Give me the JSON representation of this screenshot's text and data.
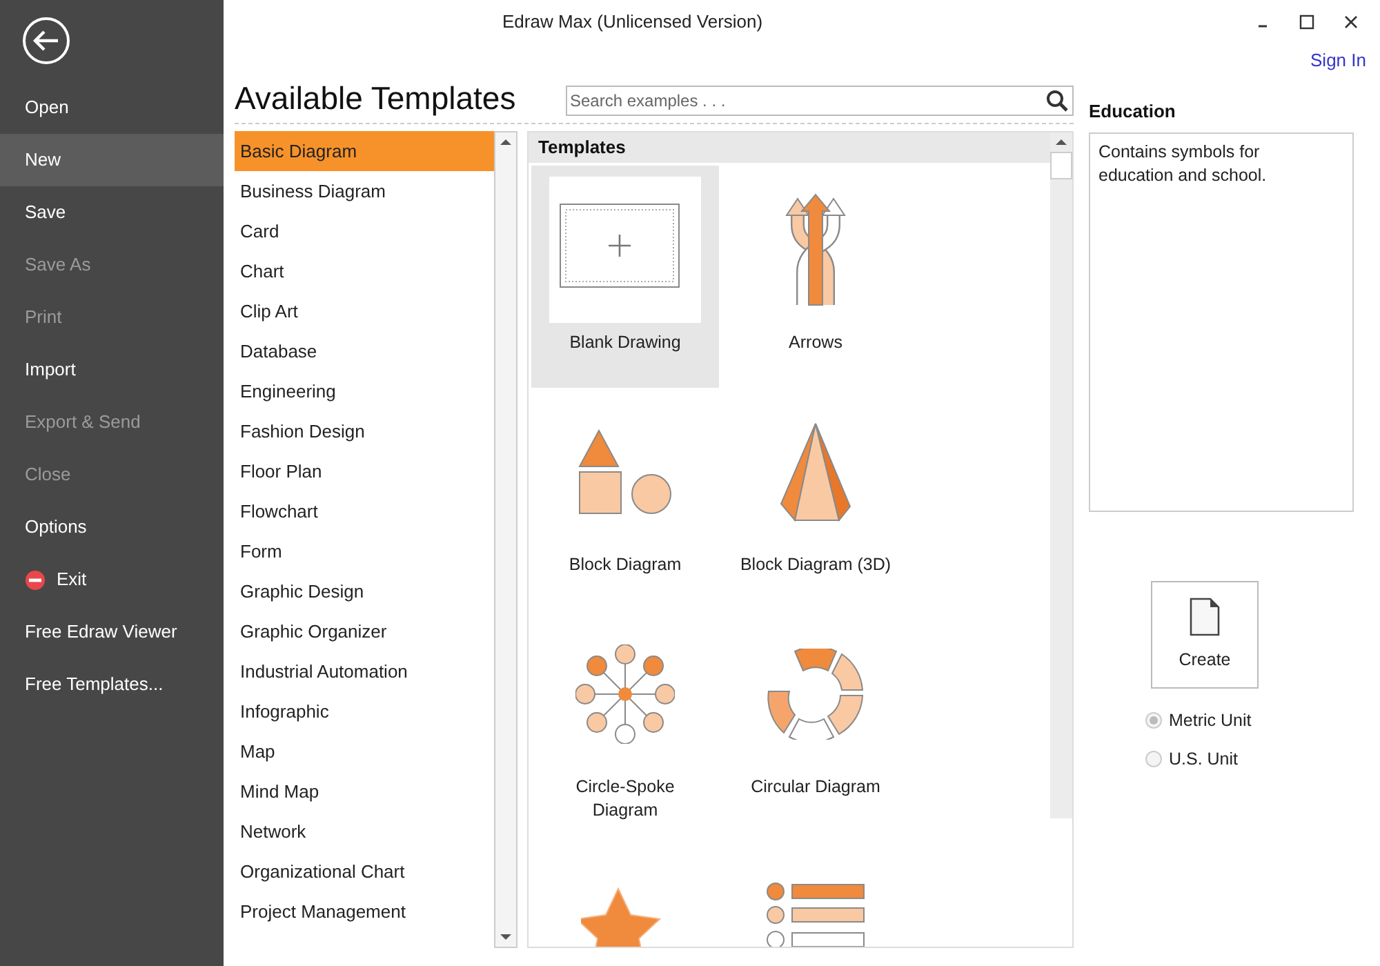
{
  "window": {
    "title": "Edraw Max (Unlicensed Version)"
  },
  "account": {
    "sign_in": "Sign In"
  },
  "sidebar": {
    "items": [
      {
        "label": "Open",
        "selected": false,
        "disabled": false,
        "kind": "text"
      },
      {
        "label": "New",
        "selected": true,
        "disabled": false,
        "kind": "text"
      },
      {
        "label": "Save",
        "selected": false,
        "disabled": false,
        "kind": "text"
      },
      {
        "label": "Save As",
        "selected": false,
        "disabled": true,
        "kind": "text"
      },
      {
        "label": "Print",
        "selected": false,
        "disabled": true,
        "kind": "text"
      },
      {
        "label": "Import",
        "selected": false,
        "disabled": false,
        "kind": "text"
      },
      {
        "label": "Export & Send",
        "selected": false,
        "disabled": true,
        "kind": "text"
      },
      {
        "label": "Close",
        "selected": false,
        "disabled": true,
        "kind": "text"
      },
      {
        "label": "Options",
        "selected": false,
        "disabled": false,
        "kind": "text"
      },
      {
        "label": "Exit",
        "selected": false,
        "disabled": false,
        "kind": "exit"
      },
      {
        "label": "Free Edraw Viewer",
        "selected": false,
        "disabled": false,
        "kind": "text"
      },
      {
        "label": "Free Templates...",
        "selected": false,
        "disabled": false,
        "kind": "text"
      }
    ]
  },
  "heading": "Available Templates",
  "search": {
    "placeholder": "Search examples . . ."
  },
  "categories": [
    {
      "label": "Basic Diagram",
      "selected": true
    },
    {
      "label": "Business Diagram",
      "selected": false
    },
    {
      "label": "Card",
      "selected": false
    },
    {
      "label": "Chart",
      "selected": false
    },
    {
      "label": "Clip Art",
      "selected": false
    },
    {
      "label": "Database",
      "selected": false
    },
    {
      "label": "Engineering",
      "selected": false
    },
    {
      "label": "Fashion Design",
      "selected": false
    },
    {
      "label": "Floor Plan",
      "selected": false
    },
    {
      "label": "Flowchart",
      "selected": false
    },
    {
      "label": "Form",
      "selected": false
    },
    {
      "label": "Graphic Design",
      "selected": false
    },
    {
      "label": "Graphic Organizer",
      "selected": false
    },
    {
      "label": "Industrial Automation",
      "selected": false
    },
    {
      "label": "Infographic",
      "selected": false
    },
    {
      "label": "Map",
      "selected": false
    },
    {
      "label": "Mind Map",
      "selected": false
    },
    {
      "label": "Network",
      "selected": false
    },
    {
      "label": "Organizational Chart",
      "selected": false
    },
    {
      "label": "Project Management",
      "selected": false
    }
  ],
  "templates": {
    "title": "Templates",
    "items": [
      {
        "label": "Blank Drawing",
        "selected": true,
        "kind": "blank"
      },
      {
        "label": "Arrows",
        "selected": false,
        "kind": "arrows"
      },
      {
        "label": "Block Diagram",
        "selected": false,
        "kind": "block"
      },
      {
        "label": "Block Diagram (3D)",
        "selected": false,
        "kind": "pyramid"
      },
      {
        "label": "Circle-Spoke Diagram",
        "selected": false,
        "kind": "spoke"
      },
      {
        "label": "Circular Diagram",
        "selected": false,
        "kind": "circular"
      },
      {
        "selected": false,
        "kind": "star"
      },
      {
        "selected": false,
        "kind": "list"
      }
    ]
  },
  "details": {
    "title": "Education",
    "description": "Contains symbols for education and school."
  },
  "create_button": "Create",
  "units": [
    {
      "label": "Metric Unit",
      "selected": true
    },
    {
      "label": "U.S. Unit",
      "selected": false
    }
  ]
}
